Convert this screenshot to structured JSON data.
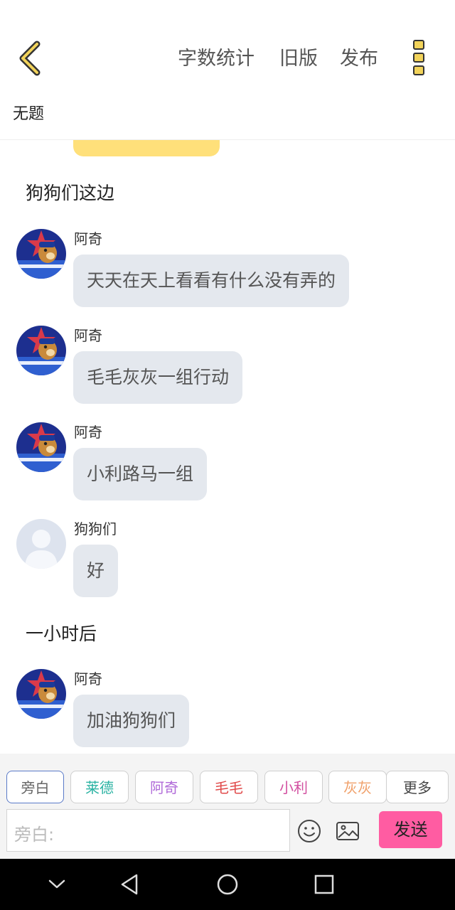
{
  "header": {
    "word_count_label": "字数统计",
    "old_version_label": "旧版",
    "publish_label": "发布",
    "title": "无题"
  },
  "chat": {
    "narrations": [
      "狗狗们这边",
      "一小时后"
    ],
    "messages": [
      {
        "sender": "阿奇",
        "text": "天天在天上看看有什么没有弄的",
        "avatar": "chase-avatar"
      },
      {
        "sender": "阿奇",
        "text": "毛毛灰灰一组行动",
        "avatar": "chase-avatar"
      },
      {
        "sender": "阿奇",
        "text": "小利路马一组",
        "avatar": "chase-avatar"
      },
      {
        "sender": "狗狗们",
        "text": "好",
        "avatar": "default-avatar"
      },
      {
        "sender": "阿奇",
        "text": "加油狗狗们",
        "avatar": "chase-avatar"
      }
    ]
  },
  "characters": [
    {
      "label": "旁白",
      "color": "#666666"
    },
    {
      "label": "莱德",
      "color": "#2bb3a3"
    },
    {
      "label": "阿奇",
      "color": "#b06ad8"
    },
    {
      "label": "毛毛",
      "color": "#e04848"
    },
    {
      "label": "小利",
      "color": "#d24fa0"
    },
    {
      "label": "灰灰",
      "color": "#f0a06a"
    },
    {
      "label": "更多",
      "color": "#444444"
    }
  ],
  "composer": {
    "placeholder": "旁白:",
    "send_label": "发送",
    "icons": [
      "emoji-icon",
      "image-icon"
    ]
  },
  "colors": {
    "accent": "#ff5ca2",
    "bubble": "#e4e8ee",
    "highlight_bubble": "#ffe07a"
  }
}
